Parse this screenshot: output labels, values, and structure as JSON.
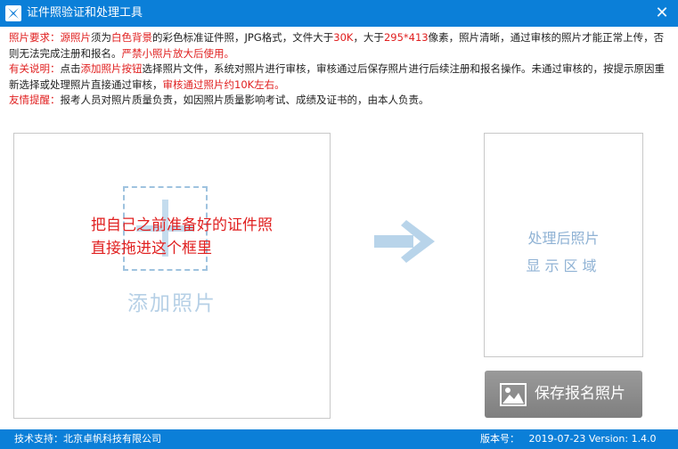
{
  "window": {
    "title": "证件照验证和处理工具",
    "close_glyph": "✕"
  },
  "info": {
    "req_label": "照片要求：",
    "req_1": "源照片",
    "req_2": "须为",
    "req_3": "白色背景",
    "req_4": "的彩色标准证件照，JPG格式，文件大于",
    "req_5": "30K",
    "req_6": "，大于",
    "req_7": "295*413",
    "req_8": "像素，照片清晰，通过审核的照片才能正常上传，否则无法完成注册和报名。",
    "req_9": "严禁小照片放大后使用。",
    "note_label": "有关说明：",
    "note_1": "点击",
    "note_2": "添加照片按钮",
    "note_3": "选择照片文件，系统对照片进行审核，审核通过后保存照片进行后续注册和报名操作。未通过审核的，按提示原因重新选择或处理照片直接通过审核，",
    "note_4": "审核通过照片约10K左右。",
    "tip_label": "友情提醒：",
    "tip_1": "报考人员对照片质量负责，如因照片质量影响考试、成绩及证书的，由本人负责。"
  },
  "upload": {
    "hint_line1": "把自己之前准备好的证件照",
    "hint_line2": "直接拖进这个框里",
    "add_label": "添加照片"
  },
  "result": {
    "line1": "处理后照片",
    "line2": "显示区域"
  },
  "save_button": {
    "label": "保存报名照片"
  },
  "status": {
    "support": "技术支持：北京卓帆科技有限公司",
    "version": "版本号：   2019-07-23 Version: 1.4.0"
  },
  "icons": {
    "app": "app-logo-icon",
    "close": "close-icon",
    "arrow": "arrow-right-icon",
    "image": "image-icon"
  },
  "colors": {
    "titlebar": "#0b7fd8",
    "accent_red": "#e02020",
    "button_gray": "#8c8c8c"
  }
}
